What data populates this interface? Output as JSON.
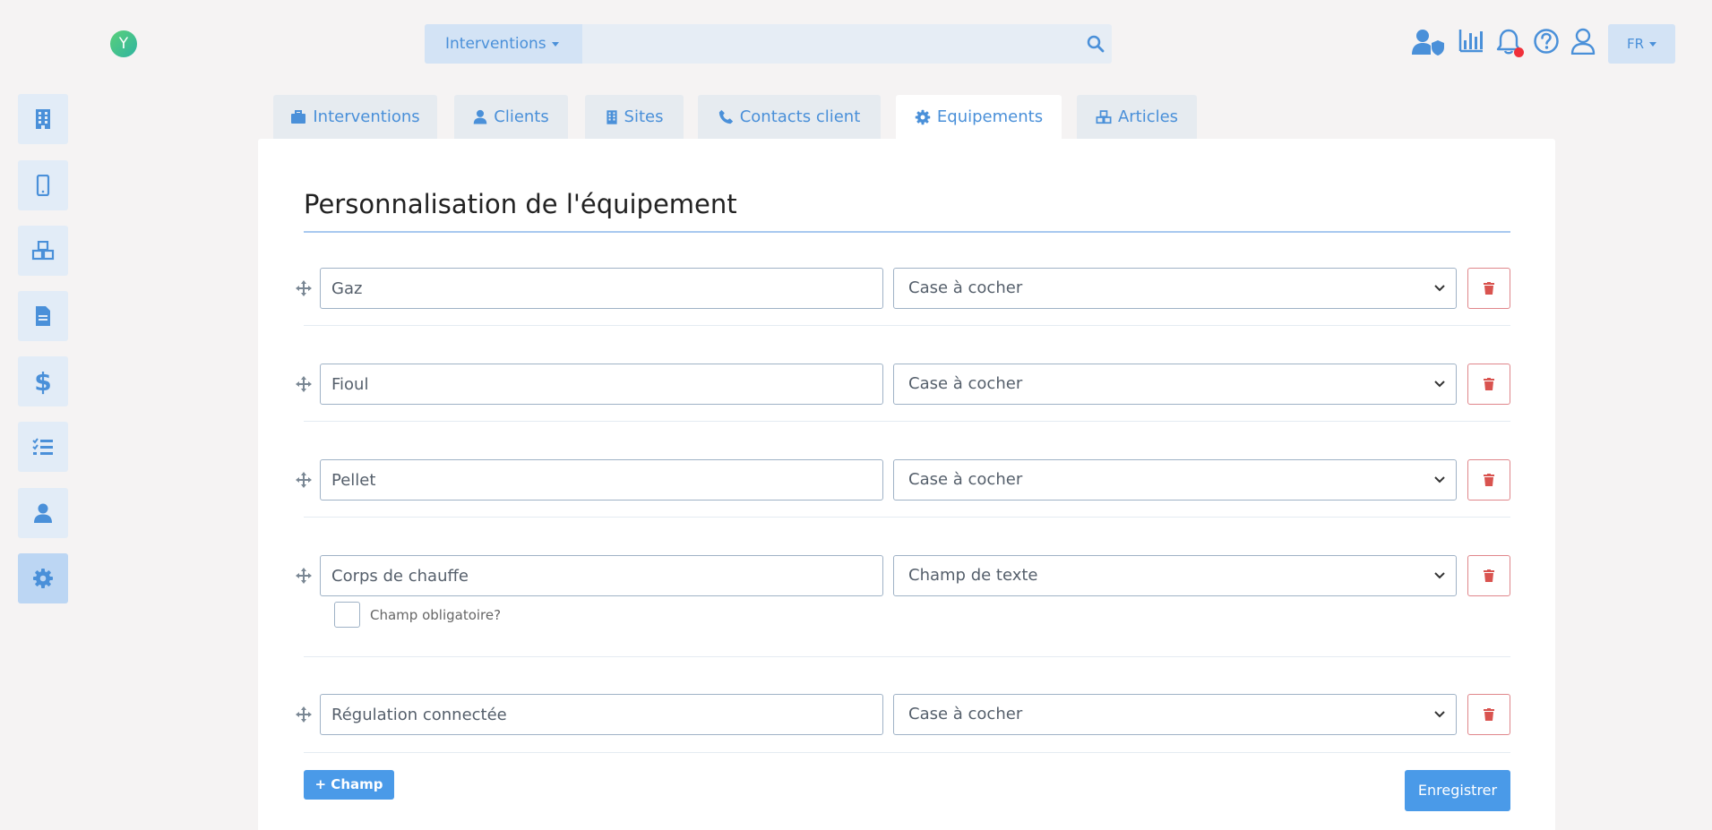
{
  "app": {
    "logo_letter": "Y"
  },
  "search": {
    "scope_label": "Interventions",
    "placeholder": ""
  },
  "header": {
    "lang_label": "FR"
  },
  "tabs": [
    {
      "label": "Interventions",
      "icon": "briefcase-icon"
    },
    {
      "label": "Clients",
      "icon": "user-icon"
    },
    {
      "label": "Sites",
      "icon": "building-icon"
    },
    {
      "label": "Contacts client",
      "icon": "phone-icon"
    },
    {
      "label": "Equipements",
      "icon": "gear-icon",
      "active": true
    },
    {
      "label": "Articles",
      "icon": "cubes-icon"
    }
  ],
  "sidebar": {
    "items": [
      {
        "icon": "building-icon"
      },
      {
        "icon": "mobile-icon"
      },
      {
        "icon": "cubes-icon"
      },
      {
        "icon": "document-icon"
      },
      {
        "icon": "dollar-icon"
      },
      {
        "icon": "checklist-icon"
      },
      {
        "icon": "user-icon"
      },
      {
        "icon": "gear-icon",
        "active": true
      }
    ]
  },
  "page": {
    "title": "Personnalisation de l'équipement"
  },
  "fields": [
    {
      "name": "Gaz",
      "type": "Case à cocher"
    },
    {
      "name": "Fioul",
      "type": "Case à cocher"
    },
    {
      "name": "Pellet",
      "type": "Case à cocher"
    },
    {
      "name": "Corps de chauffe",
      "type": "Champ de texte",
      "required_label": "Champ obligatoire?"
    },
    {
      "name": "Régulation connectée",
      "type": "Case à cocher"
    }
  ],
  "actions": {
    "add_label": "+ Champ",
    "save_label": "Enregistrer"
  },
  "colors": {
    "accent": "#4a90d9",
    "danger": "#d9534f",
    "notification": "#f0303a"
  }
}
